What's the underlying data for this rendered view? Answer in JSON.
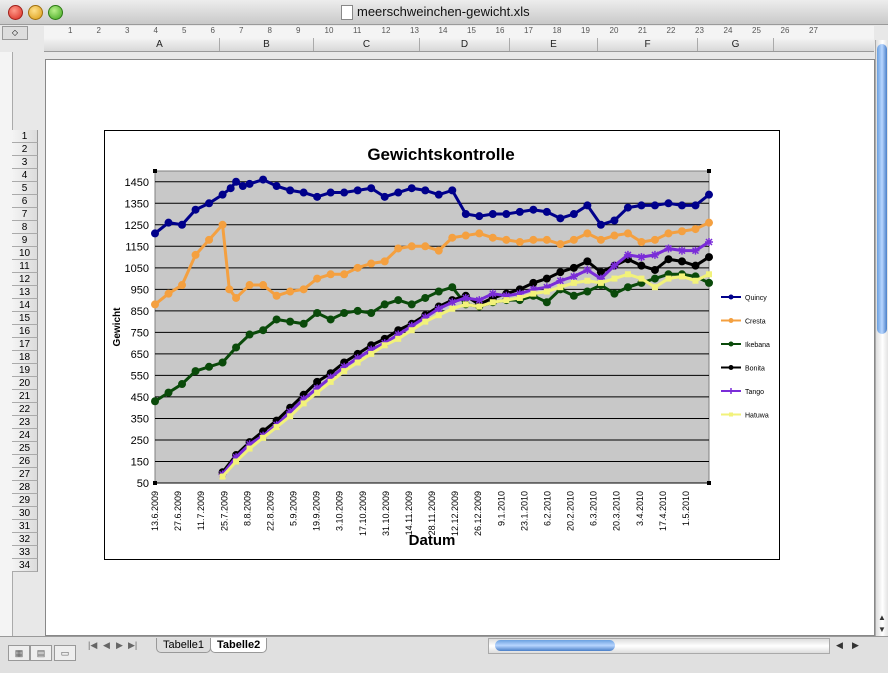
{
  "window": {
    "title": "meerschweinchen-gewicht.xls"
  },
  "ruler": {
    "labels": [
      "1",
      "2",
      "3",
      "4",
      "5",
      "6",
      "7",
      "8",
      "9",
      "10",
      "11",
      "12",
      "13",
      "14",
      "15",
      "16",
      "17",
      "18",
      "19",
      "20",
      "21",
      "22",
      "23",
      "24",
      "25",
      "26",
      "27"
    ]
  },
  "columns": [
    "A",
    "B",
    "C",
    "D",
    "E",
    "F",
    "G"
  ],
  "rows": [
    "1",
    "2",
    "3",
    "4",
    "5",
    "6",
    "7",
    "8",
    "9",
    "10",
    "11",
    "12",
    "13",
    "14",
    "15",
    "16",
    "17",
    "18",
    "19",
    "20",
    "21",
    "22",
    "23",
    "24",
    "25",
    "26",
    "27",
    "28",
    "29",
    "30",
    "31",
    "32",
    "33",
    "34"
  ],
  "sheet_tabs": [
    {
      "label": "Tabelle1",
      "active": false
    },
    {
      "label": "Tabelle2",
      "active": true
    }
  ],
  "chart_data": {
    "type": "line",
    "title": "Gewichtskontrolle",
    "xlabel": "Datum",
    "ylabel": "Gewicht",
    "ylim": [
      50,
      1500
    ],
    "yticks": [
      50,
      150,
      250,
      350,
      450,
      550,
      650,
      750,
      850,
      950,
      1050,
      1150,
      1250,
      1350,
      1450
    ],
    "grid": true,
    "legend_position": "right",
    "x_tick_labels": [
      "13.6.2009",
      "27.6.2009",
      "11.7.2009",
      "25.7.2009",
      "8.8.2009",
      "22.8.2009",
      "5.9.2009",
      "19.9.2009",
      "3.10.2009",
      "17.10.2009",
      "31.10.2009",
      "14.11.2009",
      "28.11.2009",
      "12.12.2009",
      "26.12.2009",
      "9.1.2010",
      "23.1.2010",
      "6.2.2010",
      "20.2.2010",
      "6.3.2010",
      "20.3.2010",
      "3.4.2010",
      "17.4.2010",
      "1.5.2010"
    ],
    "series": [
      {
        "name": "Quincy",
        "color": "#00008b",
        "marker": "circle",
        "values": [
          [
            0,
            1210
          ],
          [
            1,
            1260
          ],
          [
            2,
            1250
          ],
          [
            3,
            1320
          ],
          [
            4,
            1350
          ],
          [
            5,
            1390
          ],
          [
            5.6,
            1420
          ],
          [
            6,
            1450
          ],
          [
            6.5,
            1430
          ],
          [
            7,
            1440
          ],
          [
            8,
            1460
          ],
          [
            9,
            1430
          ],
          [
            10,
            1410
          ],
          [
            11,
            1400
          ],
          [
            12,
            1380
          ],
          [
            13,
            1400
          ],
          [
            14,
            1400
          ],
          [
            15,
            1410
          ],
          [
            16,
            1420
          ],
          [
            17,
            1380
          ],
          [
            18,
            1400
          ],
          [
            19,
            1420
          ],
          [
            20,
            1410
          ],
          [
            21,
            1390
          ],
          [
            22,
            1410
          ],
          [
            23,
            1300
          ],
          [
            24,
            1290
          ],
          [
            25,
            1300
          ],
          [
            26,
            1300
          ],
          [
            27,
            1310
          ],
          [
            28,
            1320
          ],
          [
            29,
            1310
          ],
          [
            30,
            1280
          ],
          [
            31,
            1300
          ],
          [
            32,
            1340
          ],
          [
            33,
            1250
          ],
          [
            34,
            1270
          ],
          [
            35,
            1330
          ],
          [
            36,
            1340
          ],
          [
            37,
            1340
          ],
          [
            38,
            1350
          ],
          [
            39,
            1340
          ],
          [
            40,
            1340
          ],
          [
            41,
            1390
          ]
        ]
      },
      {
        "name": "Cresta",
        "color": "#f4a040",
        "marker": "circle",
        "values": [
          [
            0,
            880
          ],
          [
            1,
            930
          ],
          [
            2,
            970
          ],
          [
            3,
            1110
          ],
          [
            4,
            1180
          ],
          [
            5,
            1250
          ],
          [
            5.5,
            950
          ],
          [
            6,
            910
          ],
          [
            7,
            970
          ],
          [
            8,
            970
          ],
          [
            9,
            920
          ],
          [
            10,
            940
          ],
          [
            11,
            950
          ],
          [
            12,
            1000
          ],
          [
            13,
            1020
          ],
          [
            14,
            1020
          ],
          [
            15,
            1050
          ],
          [
            16,
            1070
          ],
          [
            17,
            1080
          ],
          [
            18,
            1140
          ],
          [
            19,
            1150
          ],
          [
            20,
            1150
          ],
          [
            21,
            1130
          ],
          [
            22,
            1190
          ],
          [
            23,
            1200
          ],
          [
            24,
            1210
          ],
          [
            25,
            1190
          ],
          [
            26,
            1180
          ],
          [
            27,
            1170
          ],
          [
            28,
            1180
          ],
          [
            29,
            1180
          ],
          [
            30,
            1160
          ],
          [
            31,
            1180
          ],
          [
            32,
            1210
          ],
          [
            33,
            1180
          ],
          [
            34,
            1200
          ],
          [
            35,
            1210
          ],
          [
            36,
            1170
          ],
          [
            37,
            1180
          ],
          [
            38,
            1210
          ],
          [
            39,
            1220
          ],
          [
            40,
            1230
          ],
          [
            41,
            1260
          ]
        ]
      },
      {
        "name": "Ikebana",
        "color": "#0a4a0a",
        "marker": "circle",
        "values": [
          [
            0,
            430
          ],
          [
            1,
            470
          ],
          [
            2,
            510
          ],
          [
            3,
            570
          ],
          [
            4,
            590
          ],
          [
            5,
            610
          ],
          [
            6,
            680
          ],
          [
            7,
            740
          ],
          [
            8,
            760
          ],
          [
            9,
            810
          ],
          [
            10,
            800
          ],
          [
            11,
            790
          ],
          [
            12,
            840
          ],
          [
            13,
            810
          ],
          [
            14,
            840
          ],
          [
            15,
            850
          ],
          [
            16,
            840
          ],
          [
            17,
            880
          ],
          [
            18,
            900
          ],
          [
            19,
            880
          ],
          [
            20,
            910
          ],
          [
            21,
            940
          ],
          [
            22,
            960
          ],
          [
            23,
            880
          ],
          [
            24,
            870
          ],
          [
            25,
            890
          ],
          [
            26,
            900
          ],
          [
            27,
            900
          ],
          [
            28,
            920
          ],
          [
            29,
            890
          ],
          [
            30,
            950
          ],
          [
            31,
            920
          ],
          [
            32,
            940
          ],
          [
            33,
            970
          ],
          [
            34,
            930
          ],
          [
            35,
            960
          ],
          [
            36,
            980
          ],
          [
            37,
            1000
          ],
          [
            38,
            1020
          ],
          [
            39,
            1020
          ],
          [
            40,
            1010
          ],
          [
            41,
            980
          ]
        ]
      },
      {
        "name": "Bonita",
        "color": "#000000",
        "marker": "circle",
        "values": [
          [
            5,
            100
          ],
          [
            6,
            180
          ],
          [
            7,
            240
          ],
          [
            8,
            290
          ],
          [
            9,
            340
          ],
          [
            10,
            400
          ],
          [
            11,
            460
          ],
          [
            12,
            520
          ],
          [
            13,
            560
          ],
          [
            14,
            610
          ],
          [
            15,
            650
          ],
          [
            16,
            690
          ],
          [
            17,
            720
          ],
          [
            18,
            760
          ],
          [
            19,
            790
          ],
          [
            20,
            830
          ],
          [
            21,
            870
          ],
          [
            22,
            900
          ],
          [
            23,
            920
          ],
          [
            24,
            880
          ],
          [
            25,
            910
          ],
          [
            26,
            930
          ],
          [
            27,
            950
          ],
          [
            28,
            980
          ],
          [
            29,
            1000
          ],
          [
            30,
            1030
          ],
          [
            31,
            1050
          ],
          [
            32,
            1080
          ],
          [
            33,
            1030
          ],
          [
            34,
            1060
          ],
          [
            35,
            1090
          ],
          [
            36,
            1060
          ],
          [
            37,
            1040
          ],
          [
            38,
            1090
          ],
          [
            39,
            1080
          ],
          [
            40,
            1060
          ],
          [
            41,
            1100
          ]
        ]
      },
      {
        "name": "Tango",
        "color": "#7a2cd8",
        "marker": "star",
        "values": [
          [
            5,
            90
          ],
          [
            6,
            170
          ],
          [
            7,
            230
          ],
          [
            8,
            270
          ],
          [
            9,
            320
          ],
          [
            10,
            380
          ],
          [
            11,
            440
          ],
          [
            12,
            490
          ],
          [
            13,
            540
          ],
          [
            14,
            590
          ],
          [
            15,
            630
          ],
          [
            16,
            670
          ],
          [
            17,
            700
          ],
          [
            18,
            740
          ],
          [
            19,
            780
          ],
          [
            20,
            820
          ],
          [
            21,
            860
          ],
          [
            22,
            890
          ],
          [
            23,
            910
          ],
          [
            24,
            900
          ],
          [
            25,
            930
          ],
          [
            26,
            920
          ],
          [
            27,
            930
          ],
          [
            28,
            950
          ],
          [
            29,
            960
          ],
          [
            30,
            990
          ],
          [
            31,
            1010
          ],
          [
            32,
            1040
          ],
          [
            33,
            1000
          ],
          [
            34,
            1060
          ],
          [
            35,
            1110
          ],
          [
            36,
            1100
          ],
          [
            37,
            1110
          ],
          [
            38,
            1140
          ],
          [
            39,
            1130
          ],
          [
            40,
            1130
          ],
          [
            41,
            1170
          ]
        ]
      },
      {
        "name": "Hatuwa",
        "color": "#f2f27a",
        "marker": "square",
        "values": [
          [
            5,
            80
          ],
          [
            6,
            150
          ],
          [
            7,
            210
          ],
          [
            8,
            260
          ],
          [
            9,
            310
          ],
          [
            10,
            360
          ],
          [
            11,
            420
          ],
          [
            12,
            470
          ],
          [
            13,
            520
          ],
          [
            14,
            570
          ],
          [
            15,
            610
          ],
          [
            16,
            650
          ],
          [
            17,
            690
          ],
          [
            18,
            720
          ],
          [
            19,
            760
          ],
          [
            20,
            800
          ],
          [
            21,
            830
          ],
          [
            22,
            860
          ],
          [
            23,
            880
          ],
          [
            24,
            870
          ],
          [
            25,
            890
          ],
          [
            26,
            900
          ],
          [
            27,
            910
          ],
          [
            28,
            930
          ],
          [
            29,
            940
          ],
          [
            30,
            960
          ],
          [
            31,
            980
          ],
          [
            32,
            990
          ],
          [
            33,
            980
          ],
          [
            34,
            1000
          ],
          [
            35,
            1020
          ],
          [
            36,
            1000
          ],
          [
            37,
            960
          ],
          [
            38,
            1000
          ],
          [
            39,
            1010
          ],
          [
            40,
            990
          ],
          [
            41,
            1020
          ]
        ]
      }
    ]
  }
}
